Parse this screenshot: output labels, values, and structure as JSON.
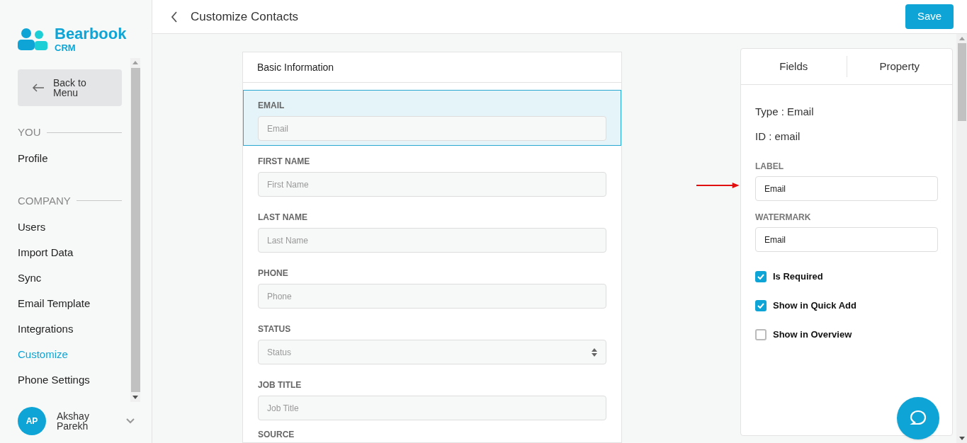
{
  "brand": {
    "name": "Bearbook",
    "sub": "CRM"
  },
  "back_button": {
    "label": "Back to Menu"
  },
  "sidebar": {
    "sections": [
      {
        "title": "YOU",
        "items": [
          {
            "label": "Profile",
            "selected": false
          }
        ]
      },
      {
        "title": "COMPANY",
        "items": [
          {
            "label": "Users",
            "selected": false
          },
          {
            "label": "Import Data",
            "selected": false
          },
          {
            "label": "Sync",
            "selected": false
          },
          {
            "label": "Email Template",
            "selected": false
          },
          {
            "label": "Integrations",
            "selected": false
          },
          {
            "label": "Customize",
            "selected": true
          },
          {
            "label": "Phone Settings",
            "selected": false
          }
        ]
      }
    ]
  },
  "user": {
    "initials": "AP",
    "name": "Akshay Parekh"
  },
  "header": {
    "title": "Customize Contacts",
    "save": "Save"
  },
  "form": {
    "section": "Basic Information",
    "fields": [
      {
        "label": "EMAIL",
        "placeholder": "Email",
        "kind": "text",
        "selected": true
      },
      {
        "label": "FIRST NAME",
        "placeholder": "First Name",
        "kind": "text",
        "selected": false
      },
      {
        "label": "LAST NAME",
        "placeholder": "Last Name",
        "kind": "text",
        "selected": false
      },
      {
        "label": "PHONE",
        "placeholder": "Phone",
        "kind": "text",
        "selected": false
      },
      {
        "label": "STATUS",
        "placeholder": "Status",
        "kind": "select",
        "selected": false
      },
      {
        "label": "JOB TITLE",
        "placeholder": "Job Title",
        "kind": "text",
        "selected": false
      },
      {
        "label": "SOURCE",
        "kind": "cut"
      }
    ]
  },
  "panel": {
    "tabs": [
      {
        "label": "Fields"
      },
      {
        "label": "Property"
      }
    ],
    "type": "Type : Email",
    "id": "ID : email",
    "inputs": [
      {
        "label": "LABEL",
        "value": "Email"
      },
      {
        "label": "WATERMARK",
        "value": "Email"
      }
    ],
    "options": [
      {
        "label": "Is Required",
        "checked": true
      },
      {
        "label": "Show in Quick Add",
        "checked": true
      },
      {
        "label": "Show in Overview",
        "checked": false
      }
    ]
  }
}
